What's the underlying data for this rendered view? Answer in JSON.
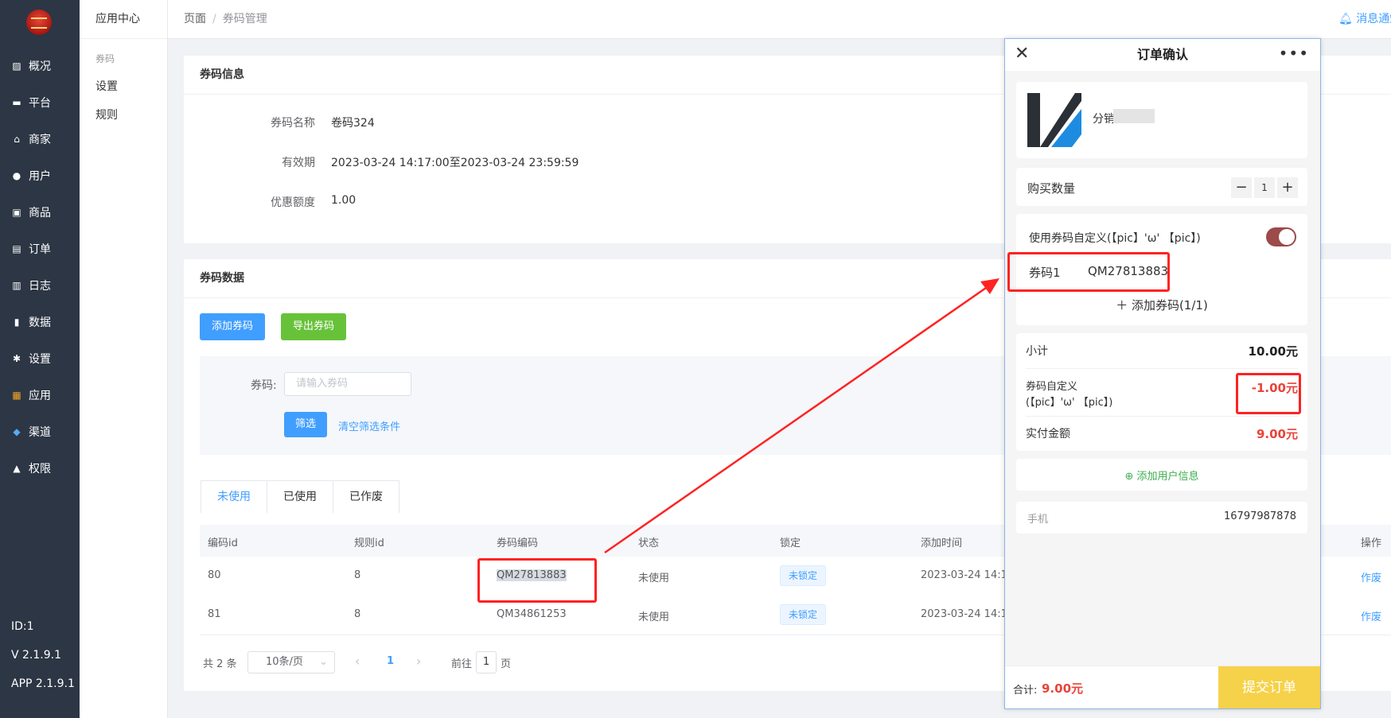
{
  "sidebar": {
    "items": [
      {
        "label": "概况",
        "icon": "chart-icon"
      },
      {
        "label": "平台",
        "icon": "monitor-icon"
      },
      {
        "label": "商家",
        "icon": "store-icon"
      },
      {
        "label": "用户",
        "icon": "user-icon"
      },
      {
        "label": "商品",
        "icon": "bag-icon"
      },
      {
        "label": "订单",
        "icon": "order-icon"
      },
      {
        "label": "日志",
        "icon": "book-icon"
      },
      {
        "label": "数据",
        "icon": "bar-chart-icon"
      },
      {
        "label": "设置",
        "icon": "gear-icon"
      },
      {
        "label": "应用",
        "icon": "apps-icon"
      },
      {
        "label": "渠道",
        "icon": "cube-icon"
      },
      {
        "label": "权限",
        "icon": "lock-icon"
      }
    ],
    "id_text": "ID:1",
    "version": "V 2.1.9.1",
    "app_version": "APP 2.1.9.1"
  },
  "subsidebar": {
    "header": "应用中心",
    "group": "券码",
    "items": [
      "设置",
      "规则"
    ]
  },
  "topbar": {
    "breadcrumb": [
      "页面",
      "券码管理"
    ],
    "sep": "/",
    "notice": "消息通知"
  },
  "info_card": {
    "title": "券码信息",
    "rows": [
      {
        "label": "券码名称",
        "value": "卷码324"
      },
      {
        "label": "有效期",
        "value": "2023-03-24 14:17:00至2023-03-24 23:59:59"
      },
      {
        "label": "优惠额度",
        "value": "1.00"
      }
    ]
  },
  "data_card": {
    "title": "券码数据",
    "add_btn": "添加券码",
    "export_btn": "导出券码",
    "filter_label": "券码:",
    "filter_placeholder": "请输入券码",
    "filter_btn": "筛选",
    "clear_link": "清空筛选条件",
    "tabs": [
      "未使用",
      "已使用",
      "已作废"
    ],
    "columns": [
      "编码id",
      "规则id",
      "券码编码",
      "状态",
      "锁定",
      "添加时间",
      "操作"
    ],
    "rows": [
      {
        "id": "80",
        "rule": "8",
        "code": "QM27813883",
        "status": "未使用",
        "lock": "未锁定",
        "time": "2023-03-24 14:1",
        "action": "作废"
      },
      {
        "id": "81",
        "rule": "8",
        "code": "QM34861253",
        "status": "未使用",
        "lock": "未锁定",
        "time": "2023-03-24 14:1",
        "action": "作废"
      }
    ],
    "pager": {
      "total": "共 2 条",
      "size": "10条/页",
      "prev": "‹",
      "page": "1",
      "next": "›",
      "goto_pre": "前往",
      "goto_val": "1",
      "goto_post": "页"
    }
  },
  "phone": {
    "title": "订单确认",
    "close": "✕",
    "more": "•••",
    "shop_name": "分销",
    "qty_label": "购买数量",
    "qty_minus": "−",
    "qty_value": "1",
    "qty_plus": "+",
    "coupon_toggle_label": "使用券码自定义(【pic】'ω' 【pic】)",
    "coupon_name": "券码1",
    "coupon_code": "QM27813883",
    "add_coupon": "＋ 添加券码(1/1)",
    "subtotal_label": "小计",
    "subtotal_value": "10.00元",
    "discount_label_1": "券码自定义",
    "discount_label_2": "(【pic】'ω' 【pic】)",
    "discount_value": "-1.00元",
    "paid_label": "实付金额",
    "paid_value": "9.00元",
    "add_user_info": "添加用户信息",
    "phone_label": "手机",
    "phone_value": "16797987878",
    "total_label": "合计:",
    "total_value": "9.00元",
    "submit": "提交订单"
  },
  "colors": {
    "primary": "#409eff",
    "green": "#67c23a",
    "red": "#f22",
    "yellow": "#f6d24a",
    "sidebar": "#2c3644"
  }
}
